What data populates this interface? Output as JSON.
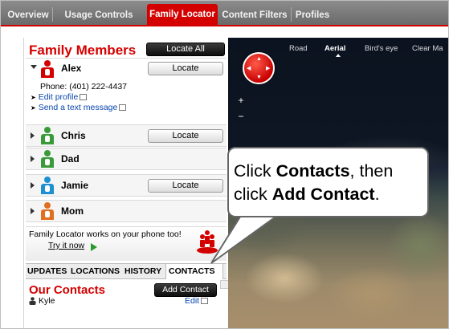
{
  "top_tabs": [
    {
      "label": "Overview",
      "active": false
    },
    {
      "label": "Usage Controls",
      "active": false
    },
    {
      "label": "Family Locator",
      "active": true
    },
    {
      "label": "Content Filters",
      "active": false
    },
    {
      "label": "Profiles",
      "active": false
    }
  ],
  "family": {
    "title": "Family Members",
    "locate_all_label": "Locate All",
    "locate_label": "Locate",
    "members": [
      {
        "name": "Alex",
        "expanded": true,
        "color": "#d40000",
        "phone": "Phone: (401) 222-4437",
        "edit_profile": "Edit profile",
        "send_text": "Send a text message"
      },
      {
        "name": "Chris",
        "color": "#3a9a3a"
      },
      {
        "name": "Dad",
        "color": "#3a9a3a"
      },
      {
        "name": "Jamie",
        "color": "#1e8fd0"
      },
      {
        "name": "Mom",
        "color": "#e07020"
      }
    ]
  },
  "promo": {
    "text": "Family Locator works on your phone too!",
    "link": "Try it now"
  },
  "sub_tabs": [
    {
      "label": "UPDATES",
      "active": false
    },
    {
      "label": "LOCATIONS",
      "active": false
    },
    {
      "label": "HISTORY",
      "active": false
    },
    {
      "label": "CONTACTS",
      "active": true
    }
  ],
  "contacts": {
    "title": "Our Contacts",
    "add_label": "Add Contact",
    "items": [
      {
        "name": "Kyle",
        "edit": "Edit"
      }
    ]
  },
  "map": {
    "views": [
      {
        "label": "Road",
        "active": false
      },
      {
        "label": "Aerial",
        "active": true
      },
      {
        "label": "Bird's eye",
        "active": false
      },
      {
        "label": "Clear Ma",
        "active": false
      }
    ],
    "zoom_in": "+",
    "zoom_out": "−"
  },
  "callout": {
    "pre1": "Click ",
    "bold1": "Contacts",
    "mid": ", then click ",
    "bold2": "Add Contact",
    "post": "."
  },
  "colors": {
    "accent": "#d40000"
  }
}
